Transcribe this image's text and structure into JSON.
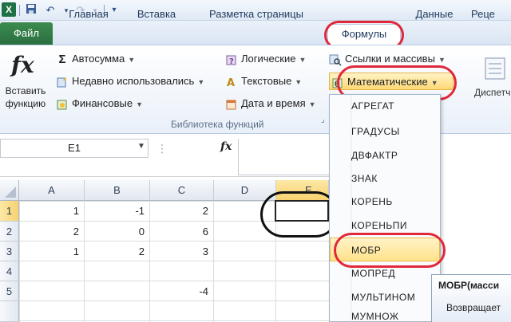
{
  "quick_access": {
    "save_icon": "save-icon",
    "undo_icon": "undo-icon",
    "redo_icon": "redo-icon"
  },
  "tabs": {
    "file": "Файл",
    "home": "Главная",
    "insert": "Вставка",
    "layout": "Разметка страницы",
    "formulas": "Формулы",
    "data": "Данные",
    "review": "Реце"
  },
  "ribbon": {
    "insert_function": {
      "symbol": "fx",
      "line1": "Вставить",
      "line2": "функцию"
    },
    "autosum": "Автосумма",
    "recent": "Недавно использовались",
    "financial": "Финансовые",
    "logical": "Логические",
    "text": "Текстовые",
    "datetime": "Дата и время",
    "lookup": "Ссылки и массивы",
    "math": "Математические",
    "group_label": "Библиотека функций",
    "right_label": "Диспетч"
  },
  "formula_bar": {
    "name_box": "E1",
    "fx": "fx"
  },
  "grid": {
    "columns": [
      "A",
      "B",
      "C",
      "D",
      "E"
    ],
    "rows": [
      "1",
      "2",
      "3",
      "4",
      "5"
    ],
    "cells": {
      "r1": [
        "1",
        "-1",
        "2"
      ],
      "r2": [
        "2",
        "0",
        "6"
      ],
      "r3": [
        "1",
        "2",
        "3"
      ],
      "r5c": "-4"
    }
  },
  "math_menu": {
    "items": [
      "АГРЕГАТ",
      "ГРАДУСЫ",
      "ДВФАКТР",
      "ЗНАК",
      "КОРЕНЬ",
      "КОРЕНЬПИ",
      "МОБР",
      "МОПРЕД",
      "МУЛЬТИНОМ",
      "МУМНОЖ"
    ],
    "highlighted": "МОБР"
  },
  "tooltip": {
    "title": "МОБР(масси",
    "text": "Возвращает"
  },
  "colors": {
    "accent_green": "#2a7040",
    "highlight_ring": "#e0283a"
  }
}
